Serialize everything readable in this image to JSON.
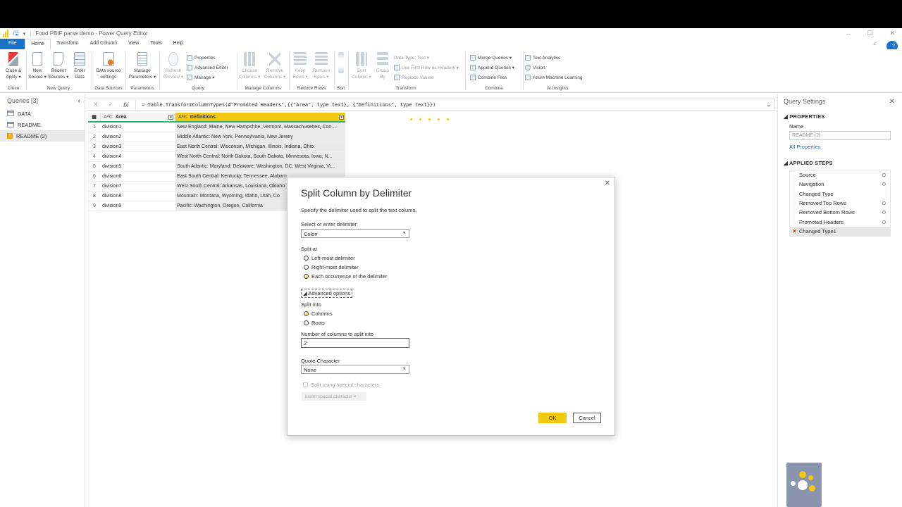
{
  "window": {
    "title": "Food PBIF parse demo - Power Query Editor",
    "controls": [
      "–",
      "☐",
      "✕"
    ]
  },
  "menu": {
    "items": [
      "File",
      "Home",
      "Transform",
      "Add Column",
      "View",
      "Tools",
      "Help"
    ]
  },
  "ribbon": {
    "close": {
      "btn": "Close &\nApply ▾",
      "label": "Close"
    },
    "newquery": {
      "b1": "New\nSource ▾",
      "b2": "Recent\nSources ▾",
      "b3": "Enter\nData",
      "label": "New Query"
    },
    "datasources": {
      "b1": "Data source\nsettings",
      "label": "Data Sources"
    },
    "parameters": {
      "b1": "Manage\nParameters ▾",
      "label": "Parameters"
    },
    "query": {
      "b1": "Refresh\nPreview ▾",
      "s1": "Properties",
      "s2": "Advanced Editor",
      "s3": "Manage ▾",
      "label": "Query"
    },
    "managecols": {
      "b1": "Choose\nColumns ▾",
      "b2": "Remove\nColumns ▾",
      "label": "Manage Columns"
    },
    "reducerows": {
      "b1": "Keep\nRows ▾",
      "b2": "Remove\nRows ▾",
      "label": "Reduce Rows"
    },
    "sort": {
      "label": "Sort"
    },
    "transform": {
      "b1": "Split\nColumn ▾",
      "b2": "Group\nBy",
      "s1": "Data Type: Text ▾",
      "s2": "Use First Row as Headers ▾",
      "s3": "Replace Values",
      "label": "Transform"
    },
    "combine": {
      "s1": "Merge Queries ▾",
      "s2": "Append Queries ▾",
      "s3": "Combine Files",
      "label": "Combine"
    },
    "ai": {
      "s1": "Text Analytics",
      "s2": "Vision",
      "s3": "Azure Machine Learning",
      "label": "AI Insights"
    }
  },
  "queries": {
    "header": "Queries [3]",
    "items": [
      {
        "label": "DATA",
        "warn": false,
        "selected": false
      },
      {
        "label": "README",
        "warn": false,
        "selected": false
      },
      {
        "label": "README (2)",
        "warn": true,
        "selected": true
      }
    ]
  },
  "formula": {
    "controls": [
      "✕",
      "✓",
      "fx"
    ],
    "text": "= Table.TransformColumnTypes(#\"Promoted Headers\",{{\"Area\", type text}, {\"Definitions\", type text}})"
  },
  "grid": {
    "columns": [
      {
        "type": "AᴬC",
        "name": "Area"
      },
      {
        "type": "AᴬC",
        "name": "Definitions"
      }
    ],
    "rows": [
      {
        "n": "1",
        "area": "division1",
        "def": "New England: Maine, New Hampshire, Vermont, Massachusettes, Con..."
      },
      {
        "n": "2",
        "area": "division2",
        "def": "Middle Atlantic: New York, Pennsylvania, New Jersey"
      },
      {
        "n": "3",
        "area": "division3",
        "def": "East North Central: Wisconsin, Michigan, Illinois, Indiana, Ohio"
      },
      {
        "n": "4",
        "area": "division4",
        "def": "West North Central: North Dakota, South Dakota, Minnesota, Iowa, N..."
      },
      {
        "n": "5",
        "area": "division5",
        "def": "South Atlantic: Maryland, Delaware, Washington, DC, West Virginia, Vi..."
      },
      {
        "n": "6",
        "area": "division6",
        "def": "East South Central: Kentucky, Tennessee, Alabam"
      },
      {
        "n": "7",
        "area": "division7",
        "def": "West South Central: Arkansas, Louisiana, Oklaho"
      },
      {
        "n": "8",
        "area": "division8",
        "def": "Mountain: Montana, Wyoming, Idaho, Utah, Co"
      },
      {
        "n": "9",
        "area": "division9",
        "def": "Pacific: Washington, Oregon, California"
      }
    ]
  },
  "settings": {
    "header": "Query Settings",
    "properties_title": "◢ PROPERTIES",
    "name_label": "Name",
    "name_value": "README (2)",
    "all_props": "All Properties",
    "steps_title": "◢ APPLIED STEPS",
    "steps": [
      {
        "label": "Source",
        "gear": true
      },
      {
        "label": "Navigation",
        "gear": true
      },
      {
        "label": "Changed Type",
        "gear": false
      },
      {
        "label": "Removed Top Rows",
        "gear": true
      },
      {
        "label": "Removed Bottom Rows",
        "gear": true
      },
      {
        "label": "Promoted Headers",
        "gear": true
      },
      {
        "label": "Changed Type1",
        "gear": false,
        "selected": true
      }
    ]
  },
  "dialog": {
    "title": "Split Column by Delimiter",
    "desc": "Specify the delimiter used to split the text column.",
    "delim_label": "Select or enter delimiter",
    "delim_value": "Colon",
    "splitat_label": "Split at",
    "splitat": [
      "Left-most delimiter",
      "Right-most delimiter",
      "Each occurrence of the delimiter"
    ],
    "splitat_selected": 2,
    "advanced": "◢ Advanced options",
    "splitinto_label": "Split into",
    "splitinto": [
      "Columns",
      "Rows"
    ],
    "splitinto_selected": 0,
    "numcols_label": "Number of columns to split into",
    "numcols_value": "2",
    "quote_label": "Quote Character",
    "quote_value": "None",
    "special_label": "Split using special characters",
    "insert_special": "Insert special character ▾",
    "ok": "OK",
    "cancel": "Cancel"
  },
  "colors": {
    "accent": "#f2c811",
    "file": "#1a73c8",
    "selected_bg": "#e8e8e8",
    "header_underline": "#2bb673"
  }
}
